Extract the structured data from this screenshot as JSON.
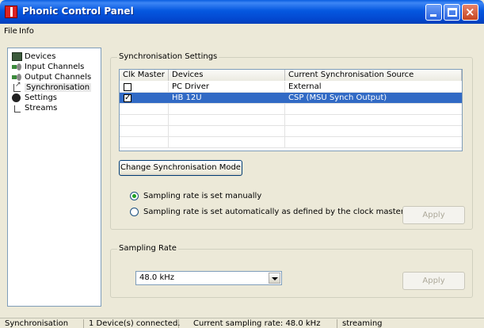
{
  "window": {
    "title": "Phonic Control Panel",
    "icon": "phonic-logo-icon"
  },
  "menu": {
    "items": [
      "File",
      "Info"
    ]
  },
  "tree": {
    "items": [
      {
        "label": "Devices",
        "icon": "devices-icon"
      },
      {
        "label": "Input Channels",
        "icon": "input-channels-icon"
      },
      {
        "label": "Output Channels",
        "icon": "output-channels-icon"
      },
      {
        "label": "Synchronisation",
        "icon": "synchronisation-icon",
        "selected": true
      },
      {
        "label": "Settings",
        "icon": "settings-icon"
      },
      {
        "label": "Streams",
        "icon": "streams-icon"
      }
    ]
  },
  "sync": {
    "title": "Synchronisation Settings",
    "columns": [
      "Clk Master",
      "Devices",
      "Current Synchronisation Source"
    ],
    "rows": [
      {
        "clk_master": false,
        "device": "PC Driver",
        "source": "External",
        "selected": false
      },
      {
        "clk_master": true,
        "device": "HB 12U",
        "source": "CSP (MSU Synch Output)",
        "selected": true
      }
    ],
    "change_mode_button": "Change Synchronisation Mode",
    "radio_manual": "Sampling rate is set manually",
    "radio_auto": "Sampling rate is set automatically as defined by the clock master",
    "selected_mode": "manual",
    "apply_label": "Apply"
  },
  "rate": {
    "title": "Sampling Rate",
    "value": "48.0 kHz",
    "apply_label": "Apply"
  },
  "status": {
    "section": "Synchronisation",
    "devices": "1 Device(s) connected.",
    "rate": "Current sampling rate: 48.0 kHz",
    "state": "streaming"
  },
  "colors": {
    "titlebar": "#0558e0",
    "selection": "#316ac5",
    "window_bg": "#ece9d8"
  }
}
